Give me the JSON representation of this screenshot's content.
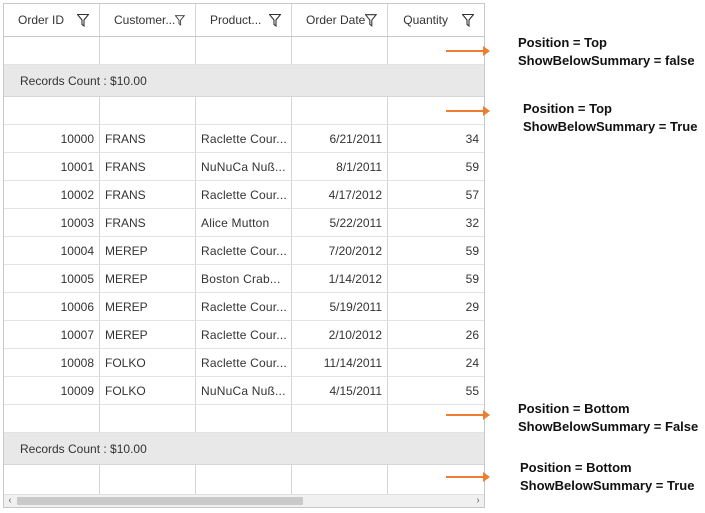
{
  "grid": {
    "columns": [
      {
        "label": "Order ID"
      },
      {
        "label": "Customer..."
      },
      {
        "label": "Product..."
      },
      {
        "label": "Order Date"
      },
      {
        "label": "Quantity"
      }
    ],
    "summary_label": "Records Count : $10.00",
    "rows": [
      [
        "10000",
        "FRANS",
        "Raclette Cour...",
        "6/21/2011",
        "34"
      ],
      [
        "10001",
        "FRANS",
        "NuNuCa Nuß...",
        "8/1/2011",
        "59"
      ],
      [
        "10002",
        "FRANS",
        "Raclette Cour...",
        "4/17/2012",
        "57"
      ],
      [
        "10003",
        "FRANS",
        "Alice Mutton",
        "5/22/2011",
        "32"
      ],
      [
        "10004",
        "MEREP",
        "Raclette Cour...",
        "7/20/2012",
        "59"
      ],
      [
        "10005",
        "MEREP",
        "Boston Crab...",
        "1/14/2012",
        "59"
      ],
      [
        "10006",
        "MEREP",
        "Raclette Cour...",
        "5/19/2011",
        "29"
      ],
      [
        "10007",
        "MEREP",
        "Raclette Cour...",
        "2/10/2012",
        "26"
      ],
      [
        "10008",
        "FOLKO",
        "Raclette Cour...",
        "11/14/2011",
        "24"
      ],
      [
        "10009",
        "FOLKO",
        "NuNuCa Nuß...",
        "4/15/2011",
        "55"
      ]
    ],
    "scroll_left": "‹",
    "scroll_right": "›"
  },
  "annotations": [
    {
      "line1": "Position = Top",
      "line2": "ShowBelowSummary = false"
    },
    {
      "line1": "Position = Top",
      "line2": "ShowBelowSummary = True"
    },
    {
      "line1": "Position = Bottom",
      "line2": "ShowBelowSummary = False"
    },
    {
      "line1": "Position = Bottom",
      "line2": "ShowBelowSummary = True"
    }
  ],
  "colors": {
    "arrow": "#ed7d31",
    "summary_bg": "#e8e8e8"
  },
  "icons": {
    "filter": "filter-icon"
  }
}
